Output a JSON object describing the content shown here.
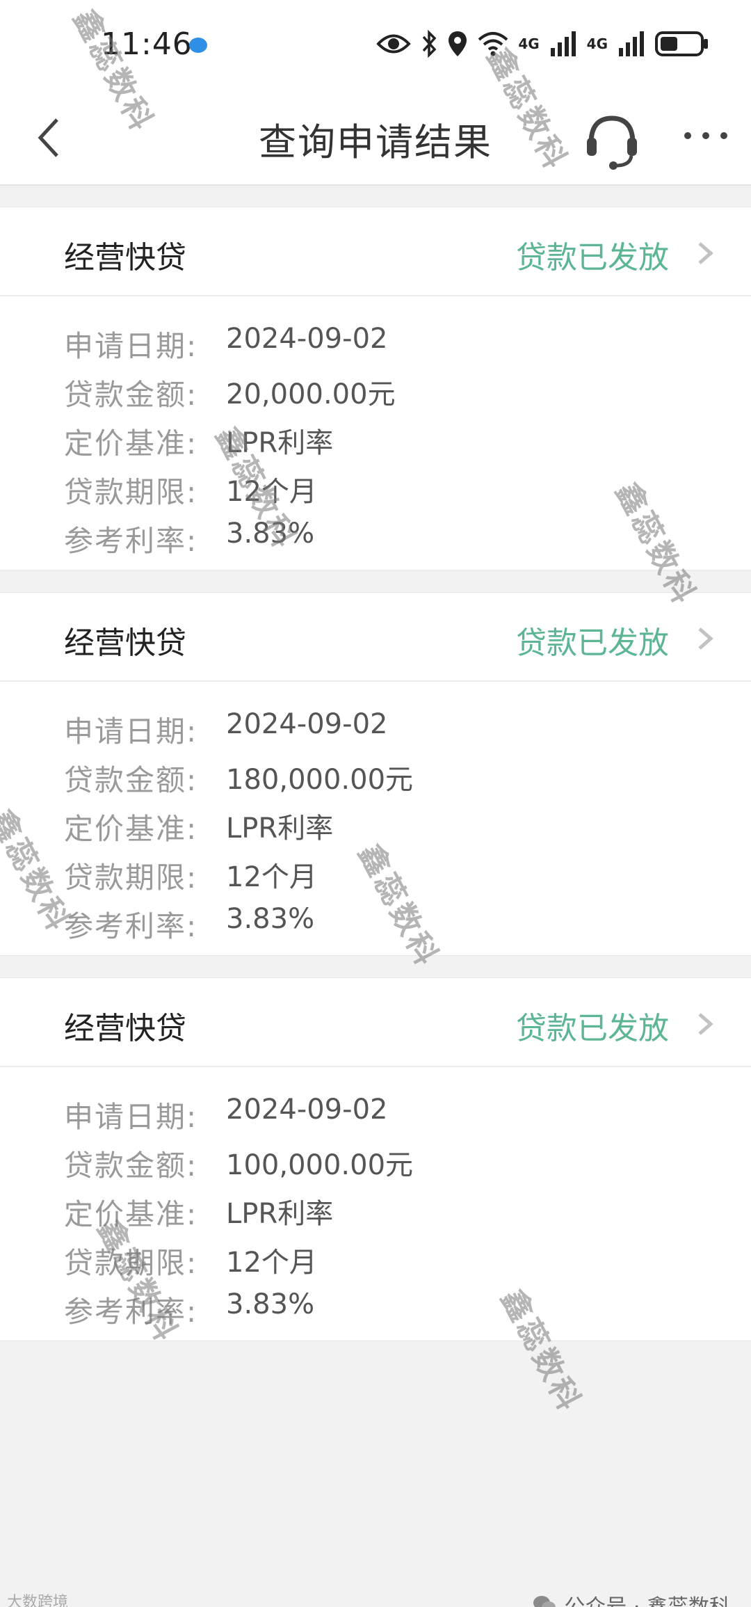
{
  "status_bar": {
    "time": "11:46",
    "net1": "4G",
    "net2": "4G"
  },
  "header": {
    "title": "查询申请结果"
  },
  "loans": [
    {
      "product": "经营快贷",
      "status": "贷款已发放",
      "fields": [
        {
          "label": "申请日期:",
          "value": "2024-09-02"
        },
        {
          "label": "贷款金额:",
          "value": "20,000.00元"
        },
        {
          "label": "定价基准:",
          "value": "LPR利率"
        },
        {
          "label": "贷款期限:",
          "value": "12个月"
        },
        {
          "label": "参考利率:",
          "value": "3.83%"
        }
      ]
    },
    {
      "product": "经营快贷",
      "status": "贷款已发放",
      "fields": [
        {
          "label": "申请日期:",
          "value": "2024-09-02"
        },
        {
          "label": "贷款金额:",
          "value": "180,000.00元"
        },
        {
          "label": "定价基准:",
          "value": "LPR利率"
        },
        {
          "label": "贷款期限:",
          "value": "12个月"
        },
        {
          "label": "参考利率:",
          "value": "3.83%"
        }
      ]
    },
    {
      "product": "经营快贷",
      "status": "贷款已发放",
      "fields": [
        {
          "label": "申请日期:",
          "value": "2024-09-02"
        },
        {
          "label": "贷款金额:",
          "value": "100,000.00元"
        },
        {
          "label": "定价基准:",
          "value": "LPR利率"
        },
        {
          "label": "贷款期限:",
          "value": "12个月"
        },
        {
          "label": "参考利率:",
          "value": "3.83%"
        }
      ]
    }
  ],
  "watermark": "鑫蕊数科",
  "footer": {
    "brand": "公众号 · 鑫蕊数科",
    "left": "大数跨境"
  },
  "colors": {
    "accent_green": "#5cb593",
    "background": "#f2f2f2"
  }
}
